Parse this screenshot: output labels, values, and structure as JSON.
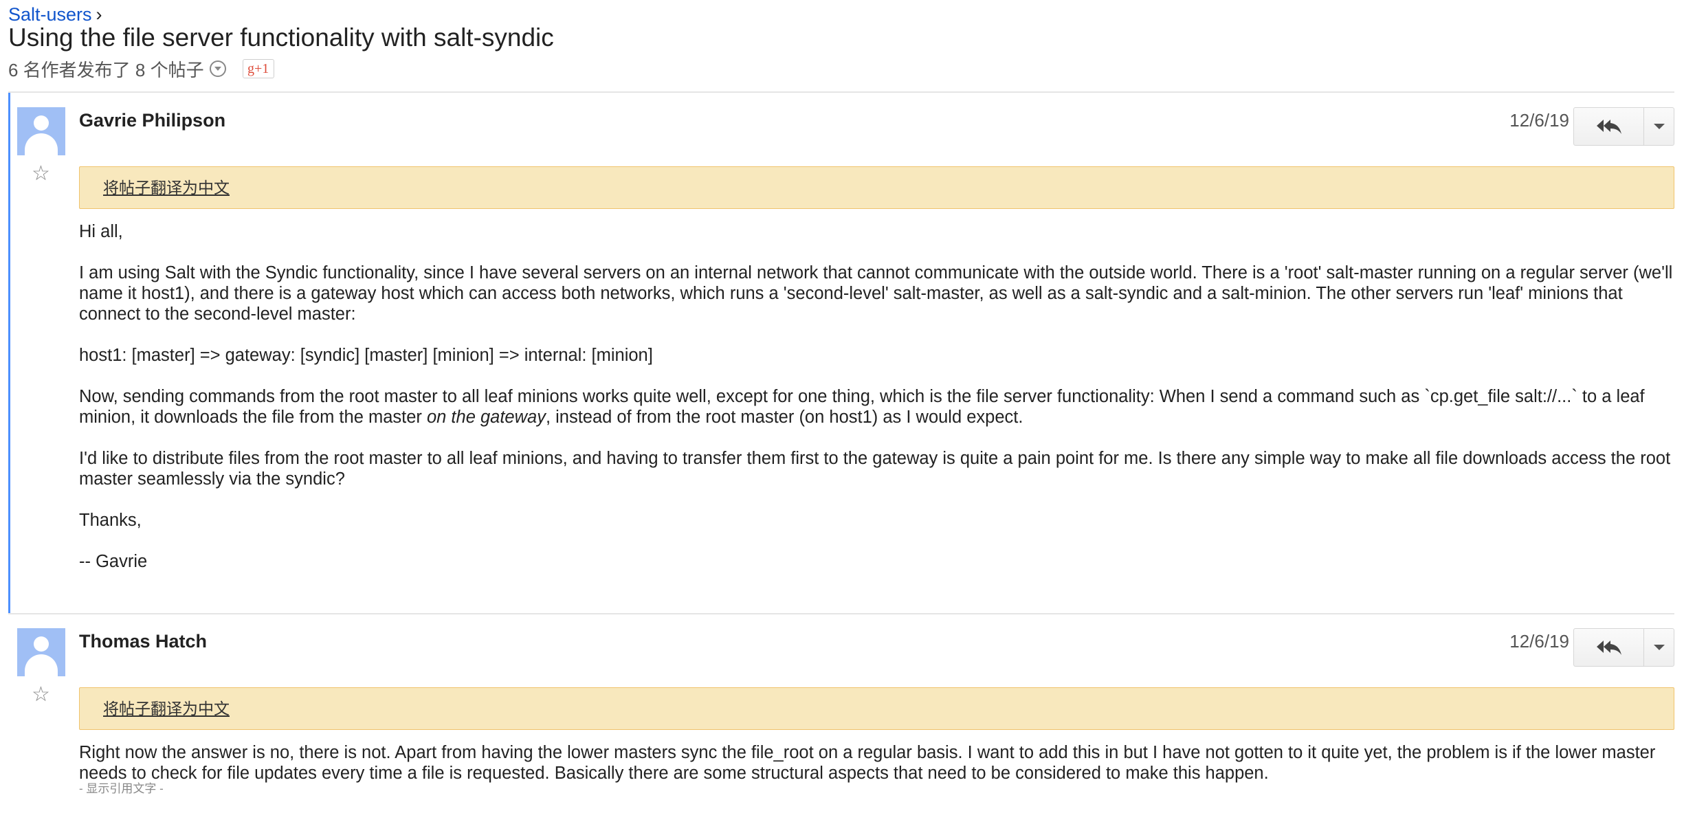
{
  "header": {
    "breadcrumb": "Salt-users",
    "breadcrumb_sep": "›",
    "title": "Using the file server functionality with salt-syndic",
    "meta": "6 名作者发布了 8 个帖子",
    "gplus_label": "g+1"
  },
  "colors": {
    "link": "#1155cc",
    "active_border": "#4d90fe",
    "translate_bg": "#f8e8bd",
    "translate_border": "#f0c36d",
    "avatar_bg": "#a0bff5"
  },
  "icons": [
    "avatar-icon",
    "star-icon",
    "reply-all-icon",
    "chevron-down-icon",
    "dropdown-circle-icon"
  ],
  "posts": [
    {
      "author": "Gavrie Philipson",
      "date": "12/6/19",
      "translate": "将帖子翻译为中文",
      "body": {
        "p1": "Hi all,",
        "p2": "I am using Salt with the Syndic functionality, since I have several servers on an internal network that cannot communicate with the outside world. There is a 'root' salt-master running on a regular server (we'll name it host1), and there is a gateway host which can access both networks, which runs a 'second-level' salt-master, as well as a salt-syndic and a salt-minion. The other servers run 'leaf' minions that connect to the second-level master:",
        "p3": "host1: [master] => gateway: [syndic] [master] [minion] => internal: [minion]",
        "p4a": "Now, sending commands from the root master to all leaf minions works quite well, except for one thing, which is the file server functionality: When I send a command such as `cp.get_file salt://...` to a leaf minion, it downloads the file from the master ",
        "p4em": "on the gateway",
        "p4b": ", instead of from the root master (on host1) as I would expect.",
        "p5": "I'd like to distribute files from the root master to all leaf minions, and having to transfer them first to the gateway is quite a pain point for me. Is there any simple way to make all file downloads access the root master seamlessly via the syndic?",
        "p6": "Thanks,",
        "p7": "-- Gavrie"
      }
    },
    {
      "author": "Thomas Hatch",
      "date": "12/6/19",
      "translate": "将帖子翻译为中文",
      "body": {
        "p1": "Right now the answer is no, there is not. Apart from having the lower masters sync the file_root on a regular basis. I want to add this in but I have not gotten to it quite yet, the problem is if the lower master needs to check for file updates every time a file is requested. Basically there are some structural aspects that need to be considered to make this happen."
      },
      "show_quoted": "- 显示引用文字 -"
    }
  ]
}
